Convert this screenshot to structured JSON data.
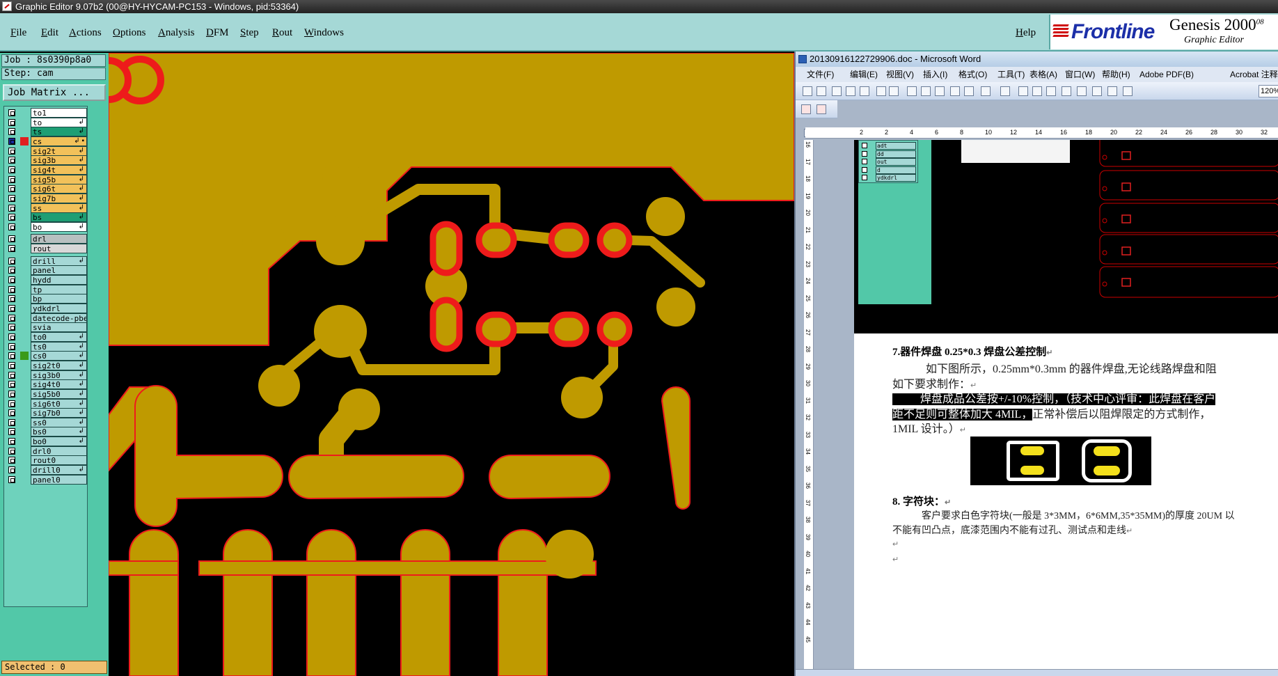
{
  "window": {
    "title": "Graphic Editor 9.07b2 (00@HY-HYCAM-PC153 - Windows, pid:53364)"
  },
  "menu": {
    "items": [
      "File",
      "Edit",
      "Actions",
      "Options",
      "Analysis",
      "DFM",
      "Step",
      "Rout",
      "Windows"
    ],
    "help": "Help"
  },
  "brand": {
    "logo": "Frontline",
    "product": "Genesis 2000",
    "product_sup": "08",
    "subtitle": "Graphic Editor"
  },
  "job": {
    "job_label": "Job : 8s0390p8a0",
    "step_label": "Step: cam",
    "matrix_button": "Job Matrix ..."
  },
  "layers": [
    {
      "name": "to1",
      "fill": "#ffffff",
      "swatch": "",
      "mark": ""
    },
    {
      "name": "to",
      "fill": "#ffffff",
      "swatch": "",
      "mark": "↲"
    },
    {
      "name": "ts",
      "fill": "#1e9e74",
      "swatch": "",
      "mark": "↲"
    },
    {
      "name": "cs",
      "fill": "#f2c15a",
      "swatch": "#e02020",
      "mark": "↲ ▪",
      "active": true
    },
    {
      "name": "sig2t",
      "fill": "#f2c15a",
      "swatch": "",
      "mark": "↲"
    },
    {
      "name": "sig3b",
      "fill": "#f2c15a",
      "swatch": "",
      "mark": "↲"
    },
    {
      "name": "sig4t",
      "fill": "#f2c15a",
      "swatch": "",
      "mark": "↲"
    },
    {
      "name": "sig5b",
      "fill": "#f2c15a",
      "swatch": "",
      "mark": "↲"
    },
    {
      "name": "sig6t",
      "fill": "#f2c15a",
      "swatch": "",
      "mark": "↲"
    },
    {
      "name": "sig7b",
      "fill": "#f2c15a",
      "swatch": "",
      "mark": "↲"
    },
    {
      "name": "ss",
      "fill": "#f2c15a",
      "swatch": "",
      "mark": "↲"
    },
    {
      "name": "bs",
      "fill": "#1e9e74",
      "swatch": "",
      "mark": "↲"
    },
    {
      "name": "bo",
      "fill": "#ffffff",
      "swatch": "",
      "mark": "↲"
    },
    {
      "name": "drl",
      "fill": "#b8c0c0",
      "swatch": "",
      "mark": "",
      "gap": true
    },
    {
      "name": "rout",
      "fill": "#d8d8d8",
      "swatch": "",
      "mark": ""
    },
    {
      "name": "drill",
      "fill": "#a5d8d6",
      "swatch": "",
      "mark": "↲",
      "gap": true
    },
    {
      "name": "panel",
      "fill": "#a5d8d6",
      "swatch": "",
      "mark": ""
    },
    {
      "name": "hydd",
      "fill": "#a5d8d6",
      "swatch": "",
      "mark": ""
    },
    {
      "name": "tp",
      "fill": "#a5d8d6",
      "swatch": "",
      "mark": ""
    },
    {
      "name": "bp",
      "fill": "#a5d8d6",
      "swatch": "",
      "mark": ""
    },
    {
      "name": "ydkdrl",
      "fill": "#a5d8d6",
      "swatch": "",
      "mark": ""
    },
    {
      "name": "datecode-pbe",
      "fill": "#a5d8d6",
      "swatch": "",
      "mark": ""
    },
    {
      "name": "svia",
      "fill": "#a5d8d6",
      "swatch": "",
      "mark": ""
    },
    {
      "name": "to0",
      "fill": "#a5d8d6",
      "swatch": "",
      "mark": "↲"
    },
    {
      "name": "ts0",
      "fill": "#a5d8d6",
      "swatch": "",
      "mark": "↲"
    },
    {
      "name": "cs0",
      "fill": "#a5d8d6",
      "swatch": "#3a9a1a",
      "mark": "↲"
    },
    {
      "name": "sig2t0",
      "fill": "#a5d8d6",
      "swatch": "",
      "mark": "↲"
    },
    {
      "name": "sig3b0",
      "fill": "#a5d8d6",
      "swatch": "",
      "mark": "↲"
    },
    {
      "name": "sig4t0",
      "fill": "#a5d8d6",
      "swatch": "",
      "mark": "↲"
    },
    {
      "name": "sig5b0",
      "fill": "#a5d8d6",
      "swatch": "",
      "mark": "↲"
    },
    {
      "name": "sig6t0",
      "fill": "#a5d8d6",
      "swatch": "",
      "mark": "↲"
    },
    {
      "name": "sig7b0",
      "fill": "#a5d8d6",
      "swatch": "",
      "mark": "↲"
    },
    {
      "name": "ss0",
      "fill": "#a5d8d6",
      "swatch": "",
      "mark": "↲"
    },
    {
      "name": "bs0",
      "fill": "#a5d8d6",
      "swatch": "",
      "mark": "↲"
    },
    {
      "name": "bo0",
      "fill": "#a5d8d6",
      "swatch": "",
      "mark": "↲"
    },
    {
      "name": "drl0",
      "fill": "#a5d8d6",
      "swatch": "",
      "mark": ""
    },
    {
      "name": "rout0",
      "fill": "#a5d8d6",
      "swatch": "",
      "mark": ""
    },
    {
      "name": "drill0",
      "fill": "#a5d8d6",
      "swatch": "",
      "mark": "↲"
    },
    {
      "name": "panel0",
      "fill": "#a5d8d6",
      "swatch": "",
      "mark": ""
    }
  ],
  "status": {
    "selected": "Selected : 0"
  },
  "colors": {
    "copper": "#bf9a00",
    "outline": "#ee1b1b",
    "panel_bg": "#52c8a8",
    "menu_bg": "#a5d8d6"
  },
  "word": {
    "title": "20130916122729906.doc - Microsoft Word",
    "menu": [
      "文件(F)",
      "编辑(E)",
      "视图(V)",
      "插入(I)",
      "格式(O)",
      "工具(T)",
      "表格(A)",
      "窗口(W)",
      "帮助(H)",
      "Adobe PDF(B)",
      "Acrobat 注释"
    ],
    "zoom": "120%",
    "ruler_h": [
      "2",
      "2",
      "4",
      "6",
      "8",
      "10",
      "12",
      "14",
      "16",
      "18",
      "20",
      "22",
      "24",
      "26",
      "28",
      "30",
      "32"
    ],
    "ruler_v": [
      "16",
      "17",
      "18",
      "19",
      "20",
      "21",
      "22",
      "23",
      "24",
      "25",
      "26",
      "27",
      "28",
      "29",
      "30",
      "31",
      "32",
      "33",
      "34",
      "35",
      "36",
      "37",
      "38",
      "39",
      "40",
      "41",
      "42",
      "43",
      "44",
      "45"
    ],
    "embed_layers": [
      "adt",
      "dd",
      "out",
      "d",
      "ydkdrl"
    ],
    "section7": {
      "num": "7.",
      "title": "器件焊盘 0.25*0.3 焊盘公差控制",
      "p1a": "如下图所示，0.25mm*0.3mm 的器件焊盘,无论线路焊盘和阻",
      "p1b": "如下要求制作：",
      "p2_hl": "焊盘成品公差按+/-10%控制，（技术中心评审：此焊盘在客户",
      "p3_hl": "距不足则可整体加大 4MIL，",
      "p3_rest": "正常补偿后以阻焊限定的方式制作，",
      "p4": "1MIL 设计。）"
    },
    "section8": {
      "title": "8. 字符块：",
      "p1a": "客户要求白色字符块(一般是 3*3MM，6*6MM,35*35MM)的厚度 20UM 以",
      "p1b": "不能有凹凸点，底漆范围内不能有过孔、测试点和走线"
    },
    "para_mark": "↵"
  }
}
